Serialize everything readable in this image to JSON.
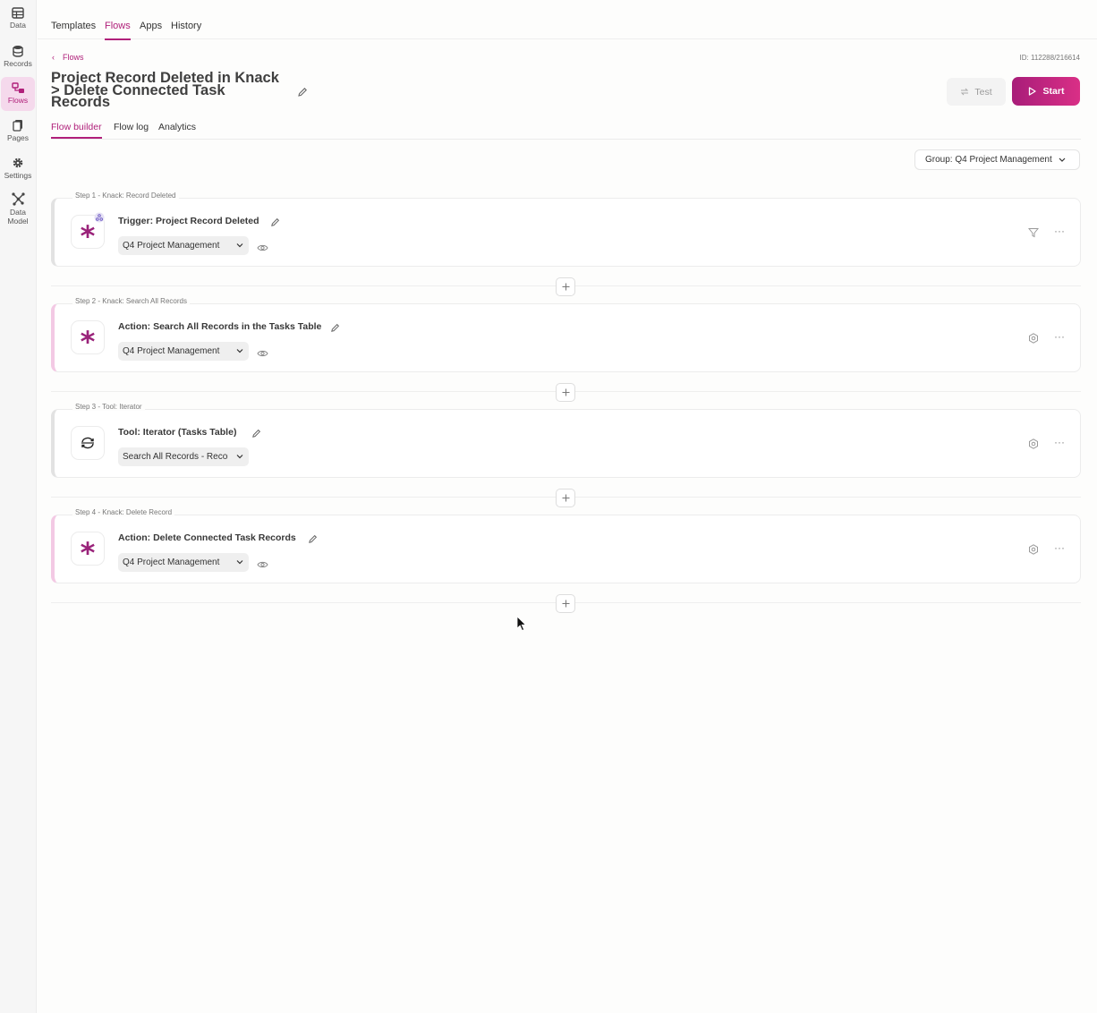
{
  "sidebar": {
    "items": [
      {
        "label": "Data",
        "icon": "table-icon"
      },
      {
        "label": "Records",
        "icon": "database-icon"
      },
      {
        "label": "Flows",
        "icon": "flows-icon",
        "active": true
      },
      {
        "label": "Pages",
        "icon": "pages-icon"
      },
      {
        "label": "Settings",
        "icon": "gear-icon"
      },
      {
        "label": "Data Model",
        "icon": "data-model-icon"
      }
    ]
  },
  "topnav": {
    "tabs": [
      {
        "label": "Templates"
      },
      {
        "label": "Flows",
        "active": true
      },
      {
        "label": "Apps"
      },
      {
        "label": "History"
      }
    ]
  },
  "header": {
    "breadcrumb": "Flows",
    "flow_id": "ID: 112288/216614",
    "title": "Project Record Deleted in Knack > Delete Connected Task Records",
    "test_label": "Test",
    "start_label": "Start"
  },
  "subtabs": [
    {
      "label": "Flow builder",
      "active": true
    },
    {
      "label": "Flow log"
    },
    {
      "label": "Analytics"
    }
  ],
  "group_select": "Group: Q4 Project Management",
  "steps": [
    {
      "label": "Step 1 - Knack: Record Deleted",
      "title": "Trigger: Project Record Deleted",
      "select": "Q4 Project Management",
      "kind": "trigger",
      "right_icon": "filter-icon"
    },
    {
      "label": "Step 2 - Knack: Search All Records",
      "title": "Action: Search All Records in the Tasks Table",
      "select": "Q4 Project Management",
      "kind": "action",
      "right_icon": "gear-icon"
    },
    {
      "label": "Step 3 - Tool: Iterator",
      "title": "Tool: Iterator (Tasks Table)",
      "select": "Search All Records - Records",
      "kind": "tool",
      "right_icon": "gear-icon"
    },
    {
      "label": "Step 4 - Knack: Delete Record",
      "title": "Action: Delete Connected Task Records",
      "select": "Q4 Project Management",
      "kind": "action",
      "right_icon": "gear-icon"
    }
  ],
  "colors": {
    "accent": "#b0207a",
    "start_gradient_from": "#a81d79",
    "start_gradient_to": "#d92f86",
    "knack_icon": "#9a237a"
  }
}
